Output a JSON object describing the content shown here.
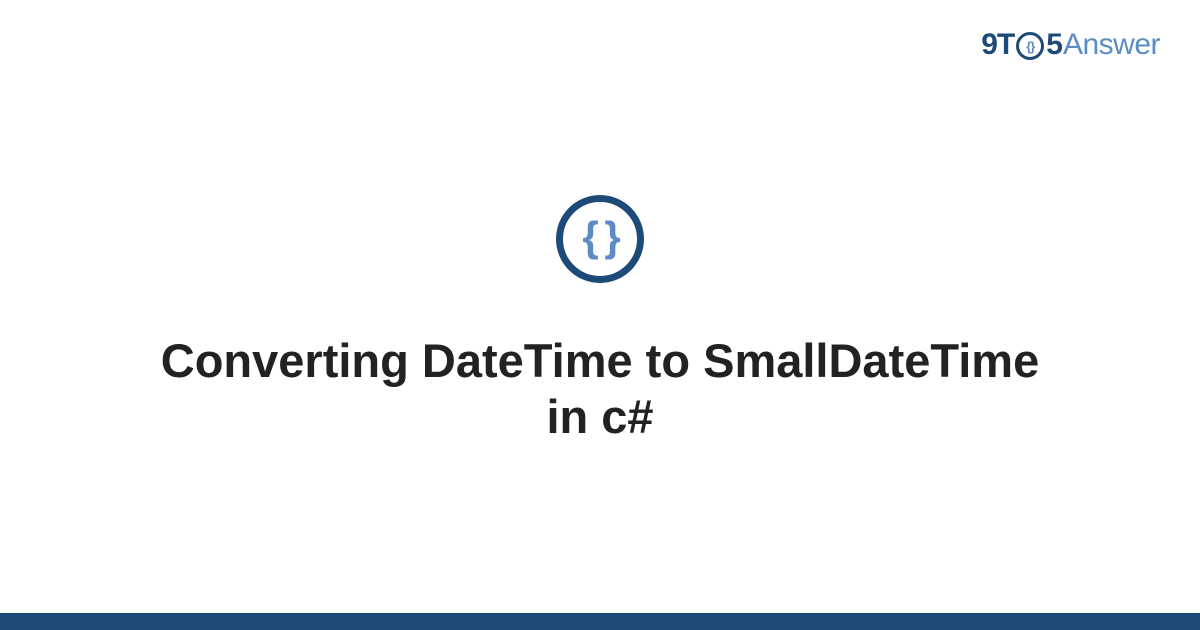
{
  "logo": {
    "part1": "9T",
    "badge_inner": "{}",
    "part2": "5",
    "part3": "Answer"
  },
  "center_badge_inner": "{ }",
  "title": "Converting DateTime to SmallDateTime in c#"
}
